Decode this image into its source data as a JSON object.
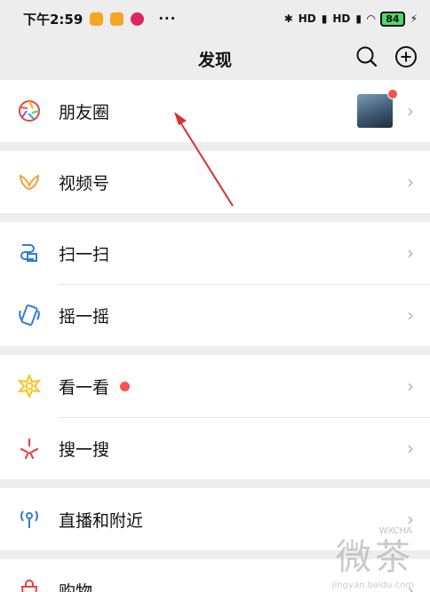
{
  "status_bar": {
    "time": "下午2:59",
    "dots": "···",
    "signal_1": "HD",
    "signal_2": "HD",
    "battery": "84"
  },
  "navbar": {
    "title": "发现",
    "search_icon": "search-icon",
    "add_icon": "plus-circle-icon"
  },
  "groups": [
    {
      "items": [
        {
          "label": "朋友圈",
          "icon": "moments-icon",
          "has_thumbnail": true,
          "has_badge_dot": true
        }
      ]
    },
    {
      "items": [
        {
          "label": "视频号",
          "icon": "channels-icon"
        }
      ]
    },
    {
      "items": [
        {
          "label": "扫一扫",
          "icon": "scan-icon"
        },
        {
          "label": "摇一摇",
          "icon": "shake-icon"
        }
      ]
    },
    {
      "items": [
        {
          "label": "看一看",
          "icon": "top-stories-icon",
          "has_badge_dot": true
        },
        {
          "label": "搜一搜",
          "icon": "search-feature-icon"
        }
      ]
    },
    {
      "items": [
        {
          "label": "直播和附近",
          "icon": "live-nearby-icon"
        }
      ]
    },
    {
      "items": [
        {
          "label": "购物",
          "icon": "shopping-icon"
        }
      ]
    }
  ],
  "colors": {
    "badge_red": "#fa5151",
    "arrow_red": "#d92f2f",
    "background": "#ededed"
  },
  "watermark": {
    "text": "微茶",
    "tag": "WXCHA",
    "site": "jingyan.baidu.com"
  }
}
